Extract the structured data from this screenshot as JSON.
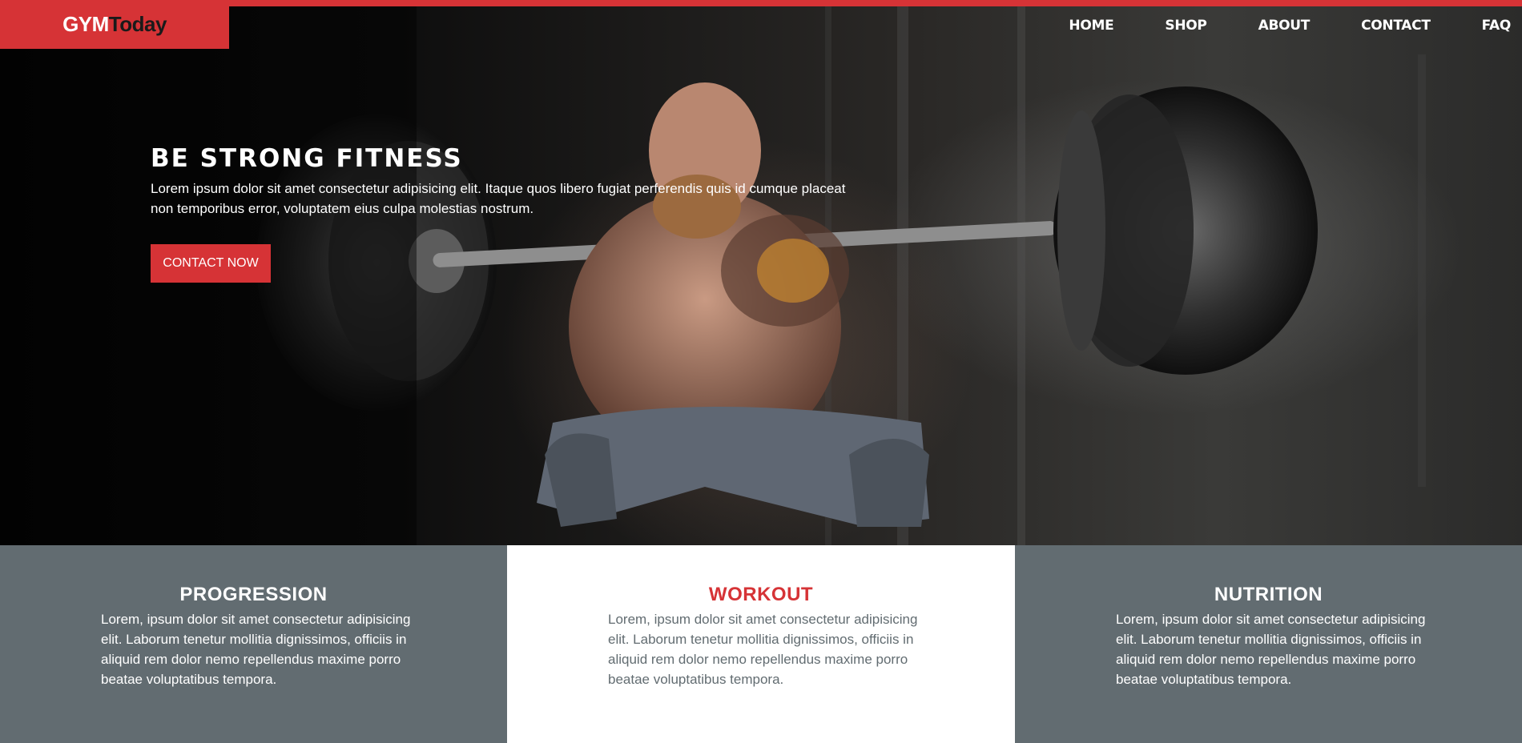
{
  "brand": {
    "part1": "GYM",
    "part2": "Today"
  },
  "nav": [
    "HOME",
    "SHOP",
    "ABOUT",
    "CONTACT",
    "FAQ"
  ],
  "hero": {
    "title": "BE STRONG FITNESS",
    "text": "Lorem ipsum dolor sit amet consectetur adipisicing elit. Itaque quos libero fugiat perferendis quis id cumque placeat non temporibus error, voluptatem eius culpa molestias nostrum.",
    "cta": "CONTACT NOW"
  },
  "features": [
    {
      "title": "PROGRESSION",
      "text": "Lorem, ipsum dolor sit amet consectetur adipisicing elit. Laborum tenetur mollitia dignissimos, officiis in aliquid rem dolor nemo repellendus maxime porro beatae voluptatibus tempora."
    },
    {
      "title": "WORKOUT",
      "text": "Lorem, ipsum dolor sit amet consectetur adipisicing elit. Laborum tenetur mollitia dignissimos, officiis in aliquid rem dolor nemo repellendus maxime porro beatae voluptatibus tempora."
    },
    {
      "title": "NUTRITION",
      "text": "Lorem, ipsum dolor sit amet consectetur adipisicing elit. Laborum tenetur mollitia dignissimos, officiis in aliquid rem dolor nemo repellendus maxime porro beatae voluptatibus tempora."
    }
  ],
  "colors": {
    "accent": "#d63336",
    "panel": "#626c71",
    "dark": "#1a1a1a",
    "white": "#ffffff"
  }
}
